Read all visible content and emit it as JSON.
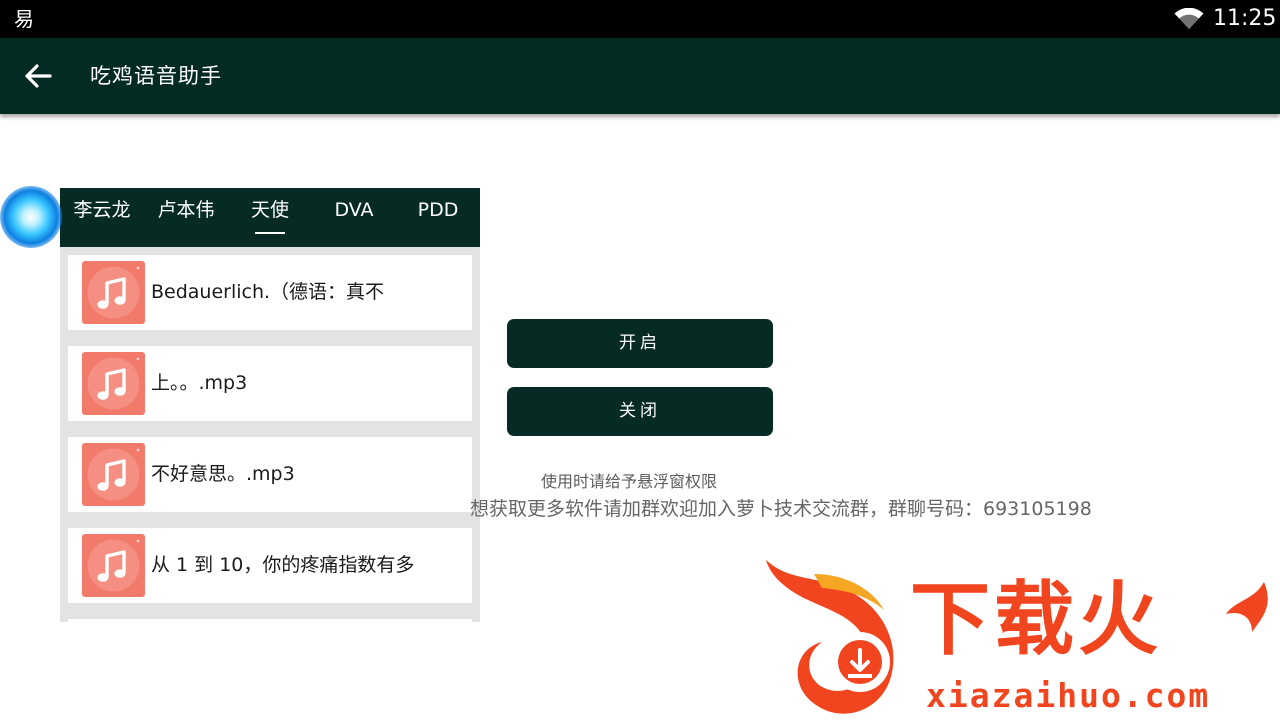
{
  "status_bar": {
    "app_icon_glyph": "易",
    "time": "11:25"
  },
  "toolbar": {
    "title": "吃鸡语音助手"
  },
  "tabs": [
    "李云龙",
    "卢本伟",
    "天使",
    "DVA",
    "PDD"
  ],
  "selected_tab": "天使",
  "list_items": [
    "Bedauerlich.（德语：真不",
    "上。。.mp3",
    "不好意思。.mp3",
    "从 1 到 10，你的疼痛指数有多"
  ],
  "buttons": {
    "start_label": "开启",
    "stop_label": "关闭"
  },
  "hint": "使用时请给予悬浮窗权限",
  "group_text": "想获取更多软件请加群欢迎加入萝卜技术交流群，群聊号码：693105198",
  "watermark": {
    "brand_text": "下载火",
    "domain": "xiazaihuo.com"
  },
  "colors": {
    "accent_dark": "#062b25",
    "watermark_orange": "#f0451e",
    "music_icon": "#f27a6b"
  },
  "icons": {
    "back": "arrow-left-icon",
    "wifi": "wifi-icon",
    "item": "music-note-icon",
    "orb": "floating-orb-icon"
  }
}
